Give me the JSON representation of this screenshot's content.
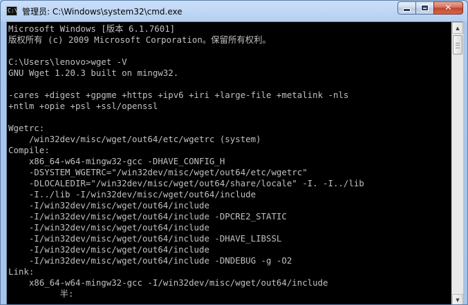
{
  "window": {
    "title": "管理员: C:\\Windows\\system32\\cmd.exe",
    "icon_name": "cmd-window-icon",
    "icon_text": "C:\\"
  },
  "console": {
    "lines": [
      "Microsoft Windows [版本 6.1.7601]",
      "版权所有 (c) 2009 Microsoft Corporation。保留所有权利。",
      "",
      "C:\\Users\\lenovo>wget -V",
      "GNU Wget 1.20.3 built on mingw32.",
      "",
      "-cares +digest +gpgme +https +ipv6 +iri +large-file +metalink -nls",
      "+ntlm +opie +psl +ssl/openssl",
      "",
      "Wgetrc:",
      "    /win32dev/misc/wget/out64/etc/wgetrc (system)",
      "Compile:",
      "    x86_64-w64-mingw32-gcc -DHAVE_CONFIG_H",
      "    -DSYSTEM_WGETRC=\"/win32dev/misc/wget/out64/etc/wgetrc\"",
      "    -DLOCALEDIR=\"/win32dev/misc/wget/out64/share/locale\" -I. -I../lib",
      "    -I../lib -I/win32dev/misc/wget/out64/include",
      "    -I/win32dev/misc/wget/out64/include",
      "    -I/win32dev/misc/wget/out64/include -DPCRE2_STATIC",
      "    -I/win32dev/misc/wget/out64/include",
      "    -I/win32dev/misc/wget/out64/include -DHAVE_LIBSSL",
      "    -I/win32dev/misc/wget/out64/include",
      "    -I/win32dev/misc/wget/out64/include -DNDEBUG -g -O2",
      "Link:",
      "    x86_64-w64-mingw32-gcc -I/win32dev/misc/wget/out64/include",
      "          半:"
    ]
  },
  "colors": {
    "console_bg": "#000000",
    "console_fg": "#c0c0c0",
    "close_button": "#c4442a"
  }
}
